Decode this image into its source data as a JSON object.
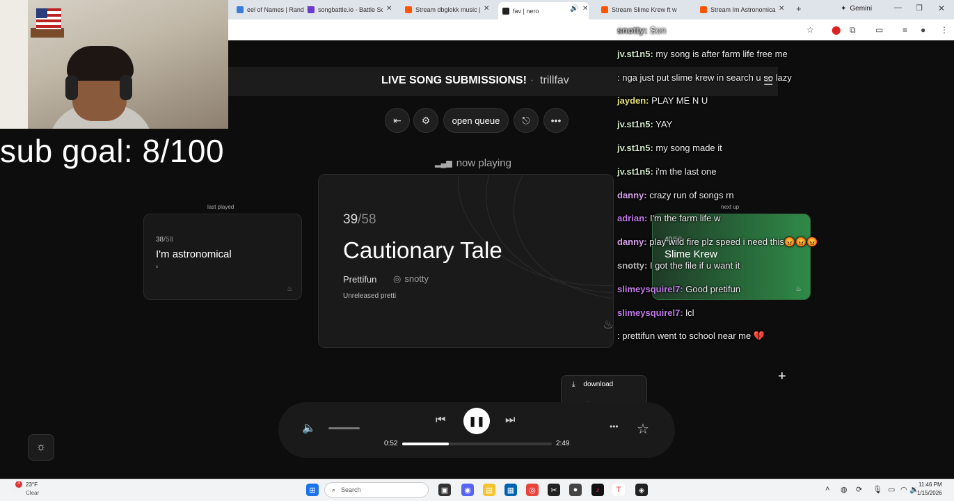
{
  "browser": {
    "tabs": [
      {
        "title": "eel of Names | Rand",
        "fav_color": "#3b7dd8"
      },
      {
        "title": "songbattle.io - Battle So",
        "fav_color": "#6c3ad0"
      },
      {
        "title": "Stream dbglokk music |",
        "fav_color": "#ff5500"
      },
      {
        "title": "fav | nero",
        "fav_color": "#222222"
      },
      {
        "title": "Stream Slime Krew ft w",
        "fav_color": "#ff5500"
      },
      {
        "title": "Stream Im Astronomica",
        "fav_color": "#ff5500"
      }
    ],
    "gemini_label": "Gemini"
  },
  "webcam_overlay": {
    "sub_goal": "sub goal: 8/100"
  },
  "banner": {
    "title": "LIVE SONG SUBMISSIONS!",
    "separator": "·",
    "host": "trillfav"
  },
  "controls": {
    "open_queue": "open queue"
  },
  "now_playing": {
    "label": "now playing",
    "index": "39",
    "total": "/58",
    "title": "Cautionary Tale",
    "artist": "Prettifun",
    "submitter": "snotty",
    "note": "Unreleased pretti"
  },
  "last_played": {
    "label": "last played",
    "index": "38",
    "total": "/58",
    "title": "I'm astronomical",
    "note": "s"
  },
  "next_up": {
    "label": "next up",
    "index": "40",
    "total": "/58",
    "title": "Slime Krew"
  },
  "player": {
    "current_time": "0:52",
    "duration": "2:49",
    "progress_fraction": 0.31,
    "volume_fraction": 1.0
  },
  "popup": {
    "download": "download",
    "flag": "flag",
    "flag_color": "#e03b3b"
  },
  "chat": [
    {
      "user": "snotty:",
      "msg": " Son",
      "color": "#bbbbbb"
    },
    {
      "user": "jv.st1n5:",
      "msg": " my song is after farm life free me",
      "color": "#cfe3c6"
    },
    {
      "user": "",
      "msg": ": nga just put slime krew in search u so lazy",
      "color": "#8a7ae0"
    },
    {
      "user": "jayden:",
      "msg": " PLAY ME N U",
      "color": "#e8e47a"
    },
    {
      "user": "jv.st1n5:",
      "msg": " YAY",
      "color": "#cfe3c6"
    },
    {
      "user": "jv.st1n5:",
      "msg": " my song made it",
      "color": "#cfe3c6"
    },
    {
      "user": "jv.st1n5:",
      "msg": " i'm the last one",
      "color": "#cfe3c6"
    },
    {
      "user": "danny:",
      "msg": " crazy run of songs rn",
      "color": "#d6a0e8"
    },
    {
      "user": "adrian:",
      "msg": " I'm the farm life w",
      "color": "#c07ae8"
    },
    {
      "user": "danny:",
      "msg": " play wild fire plz speed i need this😡😡😡",
      "color": "#d6a0e8"
    },
    {
      "user": "snotty:",
      "msg": " I got the file if u want it",
      "color": "#bbbbbb"
    },
    {
      "user": "slimeysquirel7:",
      "msg": " Good pretifun",
      "color": "#c07ae8"
    },
    {
      "user": "slimeysquirel7:",
      "msg": " lcl",
      "color": "#c07ae8"
    },
    {
      "user": "",
      "msg": ": prettifun went to school near me 💔",
      "color": "#8fd08f"
    }
  ],
  "taskbar": {
    "weather_temp": "23°F",
    "weather_desc": "Clear",
    "search": "Search",
    "time": "11:46 PM",
    "date": "1/15/2026"
  }
}
